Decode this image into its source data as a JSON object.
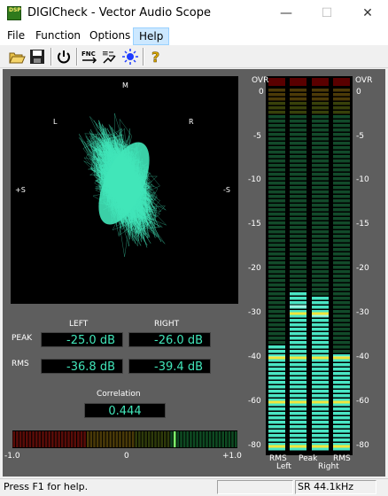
{
  "window": {
    "title": "DIGICheck - Vector Audio Scope",
    "icon_text": "DSP",
    "minimize_glyph": "—",
    "maximize_glyph": "☐",
    "close_glyph": "✕"
  },
  "menu": [
    {
      "label": "File"
    },
    {
      "label": "Function"
    },
    {
      "label": "Options"
    },
    {
      "label": "Help"
    }
  ],
  "toolbar": {
    "icons": [
      "open-folder-icon",
      "save-disk-icon",
      "power-icon",
      "fnc-icon",
      "analyzer-icon",
      "settings-sun-icon",
      "help-question-icon"
    ],
    "fnc_label": "FNC"
  },
  "scope": {
    "label_top": "M",
    "label_left": "L",
    "label_right": "R",
    "label_left_side": "+S",
    "label_right_side": "-S",
    "trace_color": "#41e5b9"
  },
  "levels": {
    "left_header": "LEFT",
    "right_header": "RIGHT",
    "peak_label": "PEAK",
    "rms_label": "RMS",
    "peak_left": "-25.0 dB",
    "peak_right": "-26.0 dB",
    "rms_left": "-36.8 dB",
    "rms_right": "-39.4 dB"
  },
  "correlation": {
    "label": "Correlation",
    "value": "0.444",
    "value_num": 0.444,
    "scale_min": "-1.0",
    "scale_mid": "0",
    "scale_max": "+1.0"
  },
  "meters": {
    "over_label": "OVR",
    "ticks": [
      "0",
      "-5",
      "-10",
      "-15",
      "-20",
      "-30",
      "-40",
      "-60",
      "-80"
    ],
    "channel_labels": [
      "RMS",
      "Peak",
      "Peak",
      "RMS"
    ],
    "left_label": "Left",
    "right_label": "Right",
    "levels_db": {
      "rms_left": -36.8,
      "peak_left": -25.0,
      "peak_right": -26.0,
      "rms_right": -39.4
    },
    "peak_hold_db": {
      "rms_left": -40.0,
      "peak_left": -28.5,
      "peak_right": -30.5,
      "rms_right": -40.0
    }
  },
  "status": {
    "help_text": "Press F1 for help.",
    "sample_rate": "SR 44.1kHz"
  }
}
